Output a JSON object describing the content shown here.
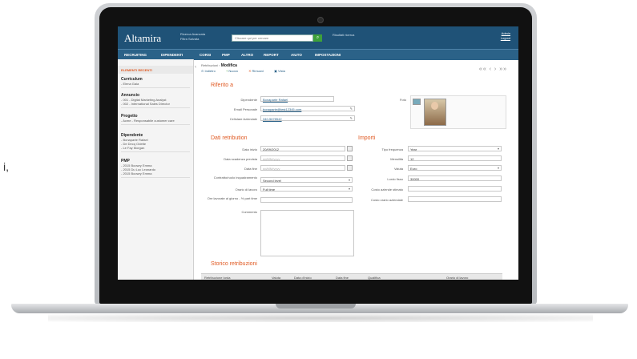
{
  "stray_text": "i,",
  "app": {
    "logo": "Altamira",
    "context": [
      "Ricerca Avanzata",
      "Filtra Salvata"
    ],
    "search_placeholder": "Cliccare qui per cercare",
    "recent": "Risultati ricerca",
    "user": [
      "Admin",
      "Logout"
    ]
  },
  "nav": [
    "RECRUITING",
    "DIPENDENTI",
    "CORSI",
    "PMP",
    "ALTRO",
    "REPORT",
    "AIUTO",
    "IMPOSTAZIONI"
  ],
  "sidebar": {
    "header": "ELEMENTI RECENTI",
    "sections": [
      {
        "title": "Curriculum",
        "lines": [
          "- Elena Gaia"
        ]
      },
      {
        "title": "Annuncio",
        "lines": [
          "- 001 - Digital Marketing Analyst",
          "- 002 - International Sales Director"
        ]
      },
      {
        "title": "Progetto",
        "lines": [
          "- Acme - Responsabile customer care"
        ]
      },
      {
        "title": "Dipendente",
        "lines": [
          "- Bonaparte Rafael",
          "- De Decq Odette",
          "- Le Fay Morgan"
        ]
      },
      {
        "title": "PMP",
        "lines": [
          "- 2015 Boowry Emma",
          "- 2015 Du Luc Leonardo",
          "- 2015 Boowry Emma"
        ]
      }
    ]
  },
  "breadcrumb": {
    "parent": "Retribuzioni",
    "current": "Modifica"
  },
  "actions": [
    "Indietro",
    "Nuovo",
    "Rimuovi",
    "Vista"
  ],
  "pager": "«« ‹ › »»",
  "form": {
    "section1": "Riferito a",
    "dipendente_label": "Dipendente",
    "dipendente_value": "Bonaparte Rafael",
    "email_label": "Email Personale",
    "email_value": "bonaparte@test12345.com",
    "cell_label": "Cellulare Aziendale",
    "cell_value": "340-5678542",
    "foto_label": "Foto",
    "section2": "Dati retribution",
    "data_inizio_label": "Data inizio",
    "data_inizio_value": "20/09/2012",
    "data_scad_label": "Data scadenza prevista",
    "data_scad_value": "dd/MM/yyyy",
    "data_fine_label": "Data fine",
    "data_fine_value": "dd/MM/yyyy",
    "contratto_label": "Contratto/ruolo inquadramento",
    "contratto_value": "Second level",
    "orario_label": "Orario di lavoro",
    "orario_value": "Full time",
    "ore_label": "Ore lavorate al giorno - % part time",
    "commento_label": "Commento",
    "section3": "Importi",
    "tipo_label": "Tipo frequenza",
    "tipo_value": "Year",
    "mensilita_label": "Mensilità",
    "mensilita_value": "12",
    "valuta_label": "Valuta",
    "valuta_value": "Euro",
    "lordo_label": "Lordo fisso",
    "lordo_value": "30000",
    "costo_stim_label": "Costo aziende stimato",
    "costo_az_label": "Costo orario aziendale",
    "section4": "Storico retribuzioni"
  },
  "table_headers": [
    "Retribuzione lorda",
    "Valuta",
    "Data d'inizio",
    "Data fine",
    "Qualifica",
    "Orario di lavoro"
  ]
}
